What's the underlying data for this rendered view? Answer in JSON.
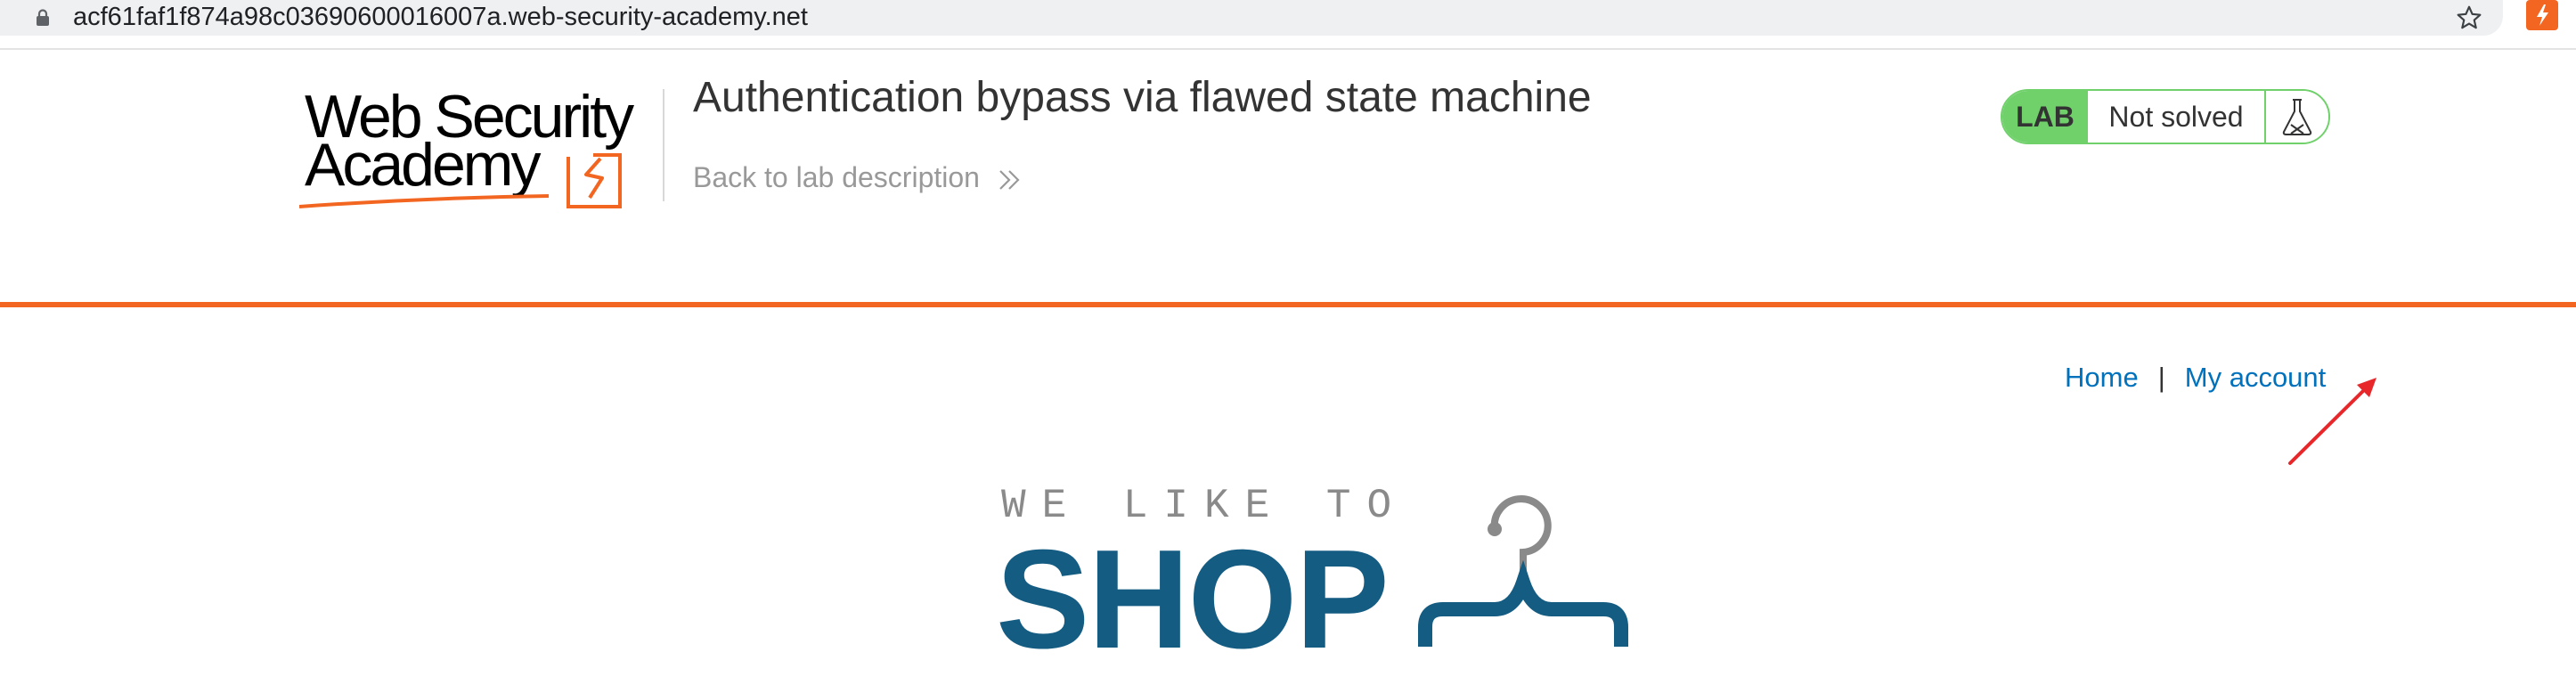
{
  "browser": {
    "url": "acf61faf1f874a98c03690600016007a.web-security-academy.net",
    "lock_icon": "lock-icon",
    "bookmark_icon": "star-icon",
    "extension_icon": "burp-extension-icon"
  },
  "header": {
    "logo_line1": "Web Security",
    "logo_line2": "Academy",
    "lab_title": "Authentication bypass via flawed state machine",
    "back_link": "Back to lab description",
    "lab_badge": {
      "tag": "LAB",
      "status": "Not solved",
      "icon": "flask-icon"
    },
    "colors": {
      "accent": "#f26622",
      "badge_green": "#70d16b",
      "link_blue": "#0071bc"
    }
  },
  "nav": {
    "home": "Home",
    "separator": "|",
    "my_account": "My account"
  },
  "hero": {
    "tagline": "WE LIKE TO",
    "brand": "SHOP",
    "brand_icon": "hanger-icon",
    "brand_color": "#145c82"
  }
}
